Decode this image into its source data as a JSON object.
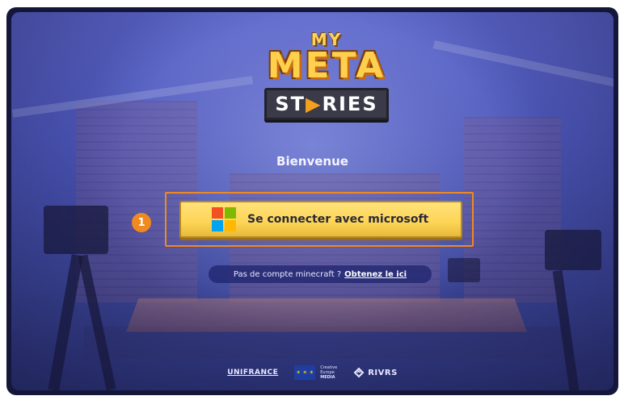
{
  "app": {
    "logo": {
      "line1": "MY",
      "line2": "META",
      "line3a": "ST",
      "line3b": "RIES",
      "play_glyph": "▶"
    },
    "welcome": "Bienvenue"
  },
  "login": {
    "button_label": "Se connecter avec microsoft",
    "icon": "microsoft-icon",
    "step_number": "1"
  },
  "signup": {
    "prompt": "Pas de compte minecraft ?",
    "link": "Obtenez le ici"
  },
  "footer": {
    "unifrance": "UNIFRANCE",
    "eu_line1": "Creative",
    "eu_line2": "Europe",
    "eu_line3": "MEDIA",
    "rivrs": "RIVRS"
  },
  "colors": {
    "accent_orange": "#f08a1e",
    "button_yellow": "#fdd455",
    "background_blue": "#4b55b6"
  }
}
